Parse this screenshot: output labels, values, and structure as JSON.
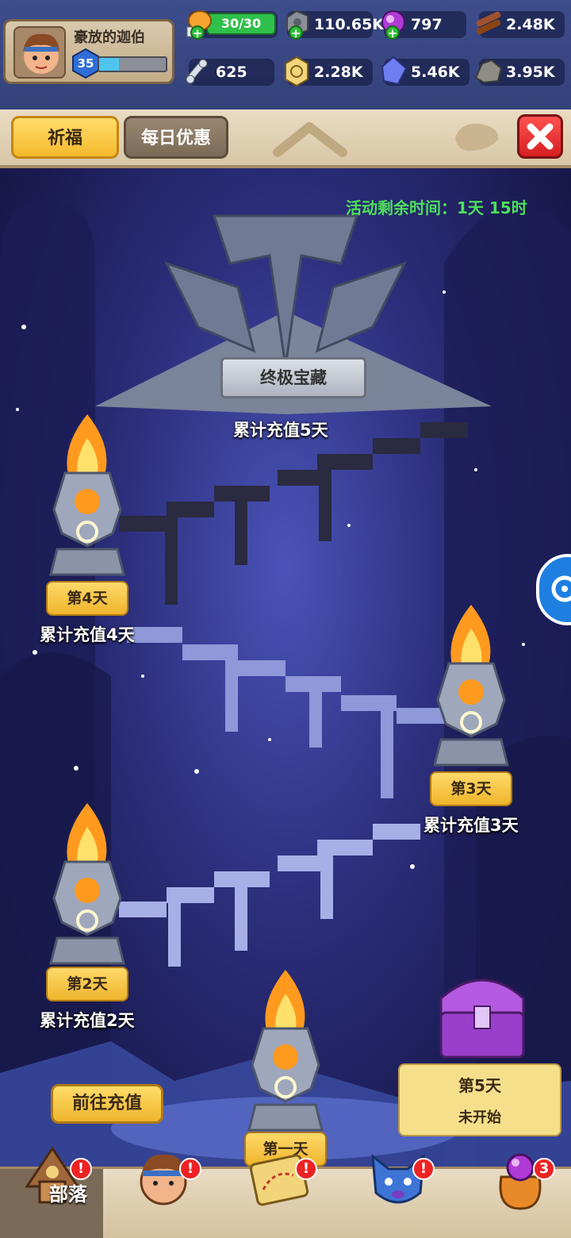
{
  "player": {
    "name": "豪放的迦伯",
    "level": "35",
    "xp_fraction": 0.3
  },
  "resources": {
    "stamina": "30/30",
    "stone": "110.65K",
    "gem_purple": "797",
    "wood": "2.48K",
    "bone": "625",
    "coin": "2.28K",
    "crystal": "5.46K",
    "ore": "3.95K"
  },
  "tabs": {
    "pray": "祈福",
    "daily": "每日优惠"
  },
  "event": {
    "timer": "活动剩余时间：1天 15时",
    "grand_title": "终极宝藏",
    "grand_sub": "累计充值5天",
    "day4_tag": "第4天",
    "day4_sub": "累计充值4天",
    "day3_tag": "第3天",
    "day3_sub": "累计充值3天",
    "day2_tag": "第2天",
    "day2_sub": "累计充值2天",
    "day1_tag": "第一天",
    "day5_title": "第5天",
    "day5_status": "未开始",
    "goto_button": "前往充值"
  },
  "bottom_nav": {
    "tribe_label": "部落",
    "bag_badge": "3",
    "alert_glyph": "!"
  },
  "colors": {
    "accent_yellow": "#f5b92c",
    "timer_green": "#4de05a",
    "close_red": "#d62020"
  }
}
